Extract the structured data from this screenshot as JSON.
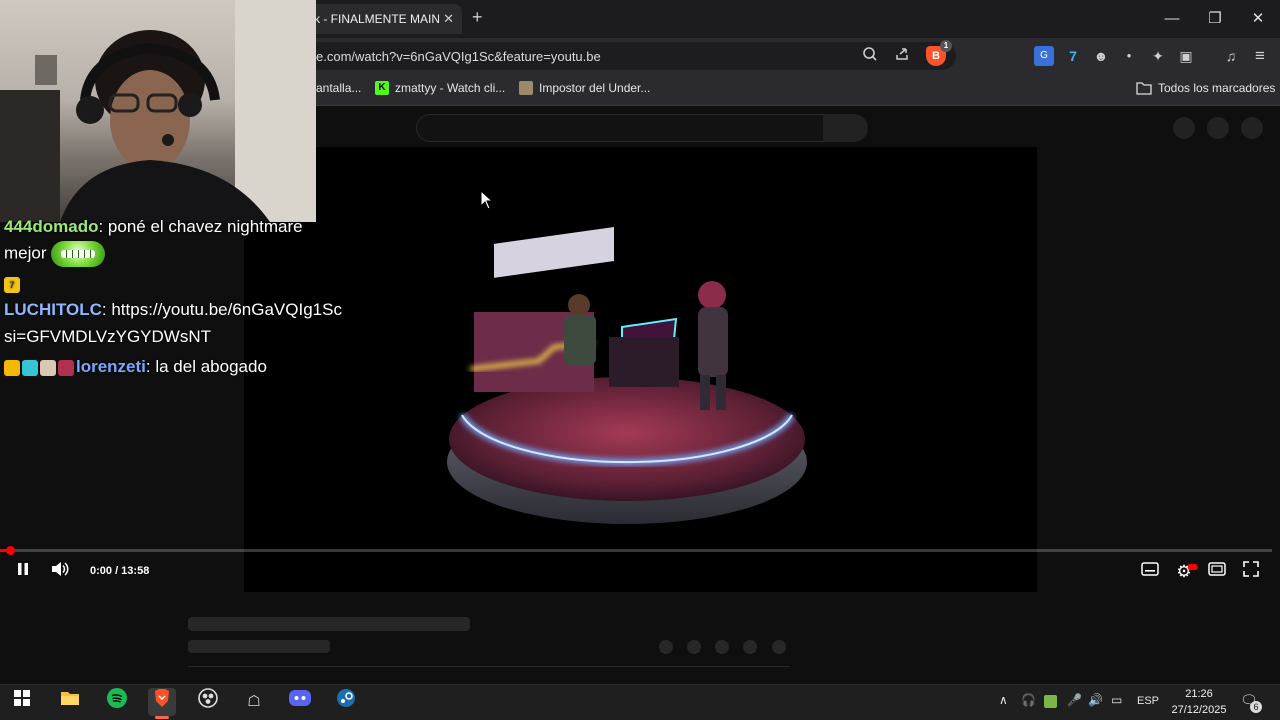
{
  "browser": {
    "tab_title": "k - FINALMENTE MAIN",
    "url": "e.com/watch?v=6nGaVQIg1Sc&feature=youtu.be",
    "shield_count": "1",
    "bookmarks": [
      {
        "label": "antalla...",
        "icon": "bookmark-page-icon",
        "color": "#888888"
      },
      {
        "label": "zmattyy - Watch cli...",
        "icon": "kick-icon",
        "color": "#53fc18"
      },
      {
        "label": "Impostor del Under...",
        "icon": "game-icon",
        "color": "#9a8a6a"
      }
    ],
    "all_bookmarks_label": "Todos los marcadores"
  },
  "player": {
    "time": "0:00 / 13:58",
    "progress_fraction": 0.0,
    "state": "playing"
  },
  "overlay": {
    "chat": [
      {
        "user": "444domado",
        "user_color": "#9be87a",
        "text": ": poné el chavez nightmare",
        "continuation": "mejor",
        "has_emote": true
      },
      {
        "user": "",
        "badge_only": true
      },
      {
        "user": "LUCHITOLC",
        "user_color": "#8fb6ff",
        "text": ": https://youtu.be/6nGaVQIg1Sc",
        "continuation": "si=GFVMDLVzYGYDWsNT"
      },
      {
        "user": "lorenzeti",
        "user_color": "#7aa7ff",
        "text": ": la del abogado"
      }
    ]
  },
  "taskbar": {
    "language": "ESP",
    "time": "21:26",
    "date": "27/12/2025",
    "notifications": "6"
  },
  "colors": {
    "accent": "#ff0000",
    "brave": "#fb542b",
    "spotify": "#1db954",
    "discord": "#5865f2"
  }
}
